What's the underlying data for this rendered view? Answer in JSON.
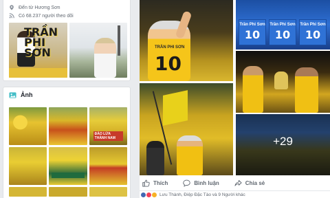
{
  "left_card": {
    "info": [
      {
        "icon": "checkin-icon",
        "text": "Đến từ Hương Sơn"
      },
      {
        "icon": "rss-icon",
        "text": "Có 68.237 người theo dõi"
      }
    ],
    "poster_text": "TRẦN\nPHI\nSƠN"
  },
  "photos": {
    "title": "Ảnh",
    "caption_g3": "ĐẢO LỬA THÀNH NAM"
  },
  "post": {
    "tile1": {
      "jersey_name": "TRẦN PHI SƠN",
      "jersey_number": "10"
    },
    "tile2": {
      "shirts": [
        {
          "name": "Trần Phi Sơn",
          "number": "10"
        },
        {
          "name": "Trần Phi Sơn",
          "number": "10"
        },
        {
          "name": "Trần Phi Sơn",
          "number": "10"
        }
      ]
    },
    "more_count": "+29",
    "actions": {
      "like": "Thích",
      "comment": "Bình luận",
      "share": "Chia sẻ"
    },
    "reactions_text": "Lưu Thành, Điệp Đặc Tào và 9 Người khác"
  },
  "colors": {
    "fb_blue": "#4267b2",
    "text_muted": "#606770",
    "page_bg": "#e9ebee"
  }
}
